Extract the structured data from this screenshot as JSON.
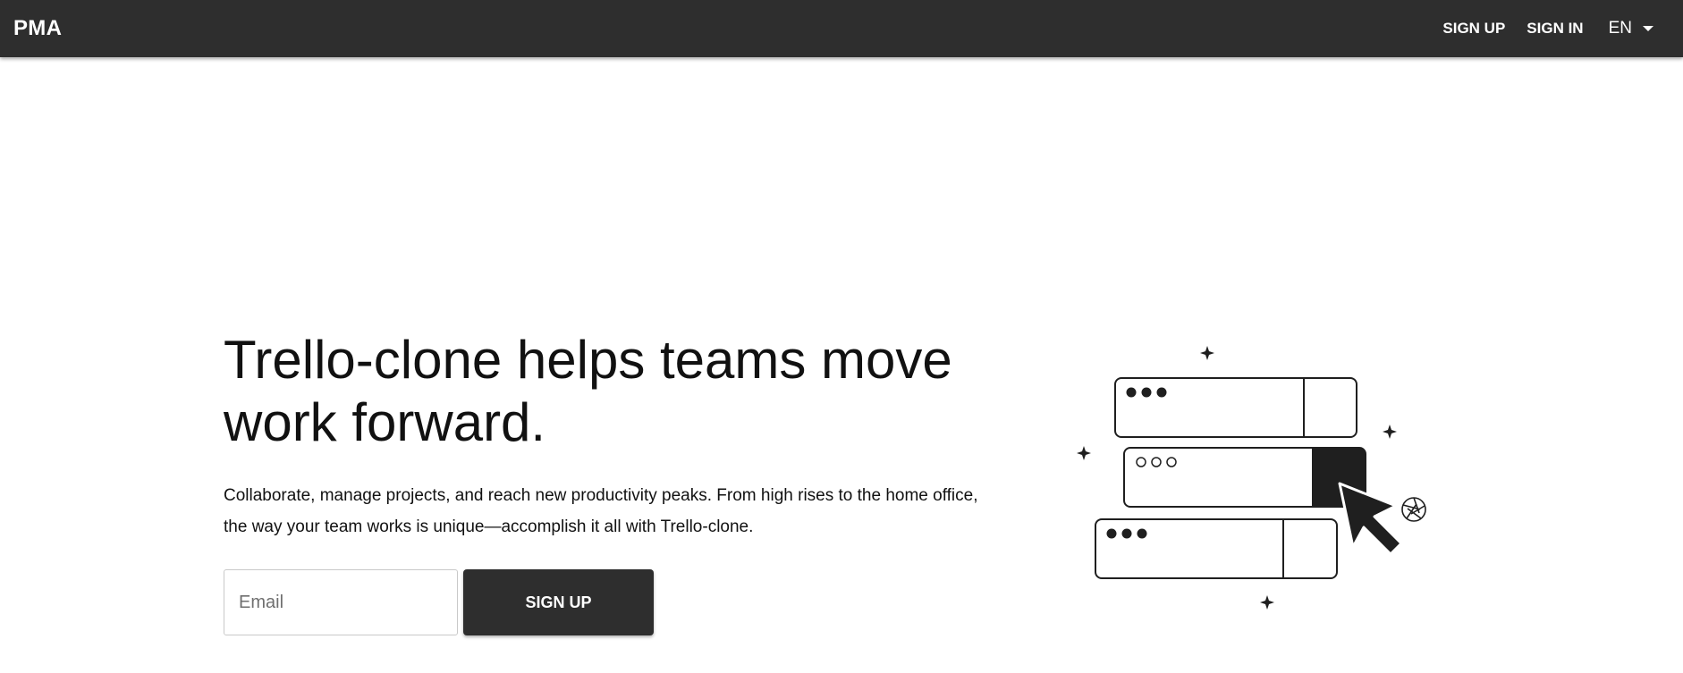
{
  "header": {
    "brand": "PMA",
    "nav": {
      "signup": "SIGN UP",
      "signin": "SIGN IN",
      "language": "EN"
    }
  },
  "hero": {
    "headline_line1": "Trello-clone helps teams move",
    "headline_line2": "work forward.",
    "lead_line1": "Collaborate, manage projects, and reach new productivity peaks. From high rises to the home office,",
    "lead_line2": "the way your team works is unique—accomplish it all with Trello-clone.",
    "email_placeholder": "Email",
    "signup_button": "SIGN UP"
  },
  "icons": [
    "chevron-down-icon",
    "sparkle-icon",
    "cursor-icon",
    "aperture-icon"
  ],
  "colors": {
    "appbar": "#2e2e2e",
    "button": "#2e2e2e",
    "text": "#111111",
    "background": "#ffffff"
  }
}
